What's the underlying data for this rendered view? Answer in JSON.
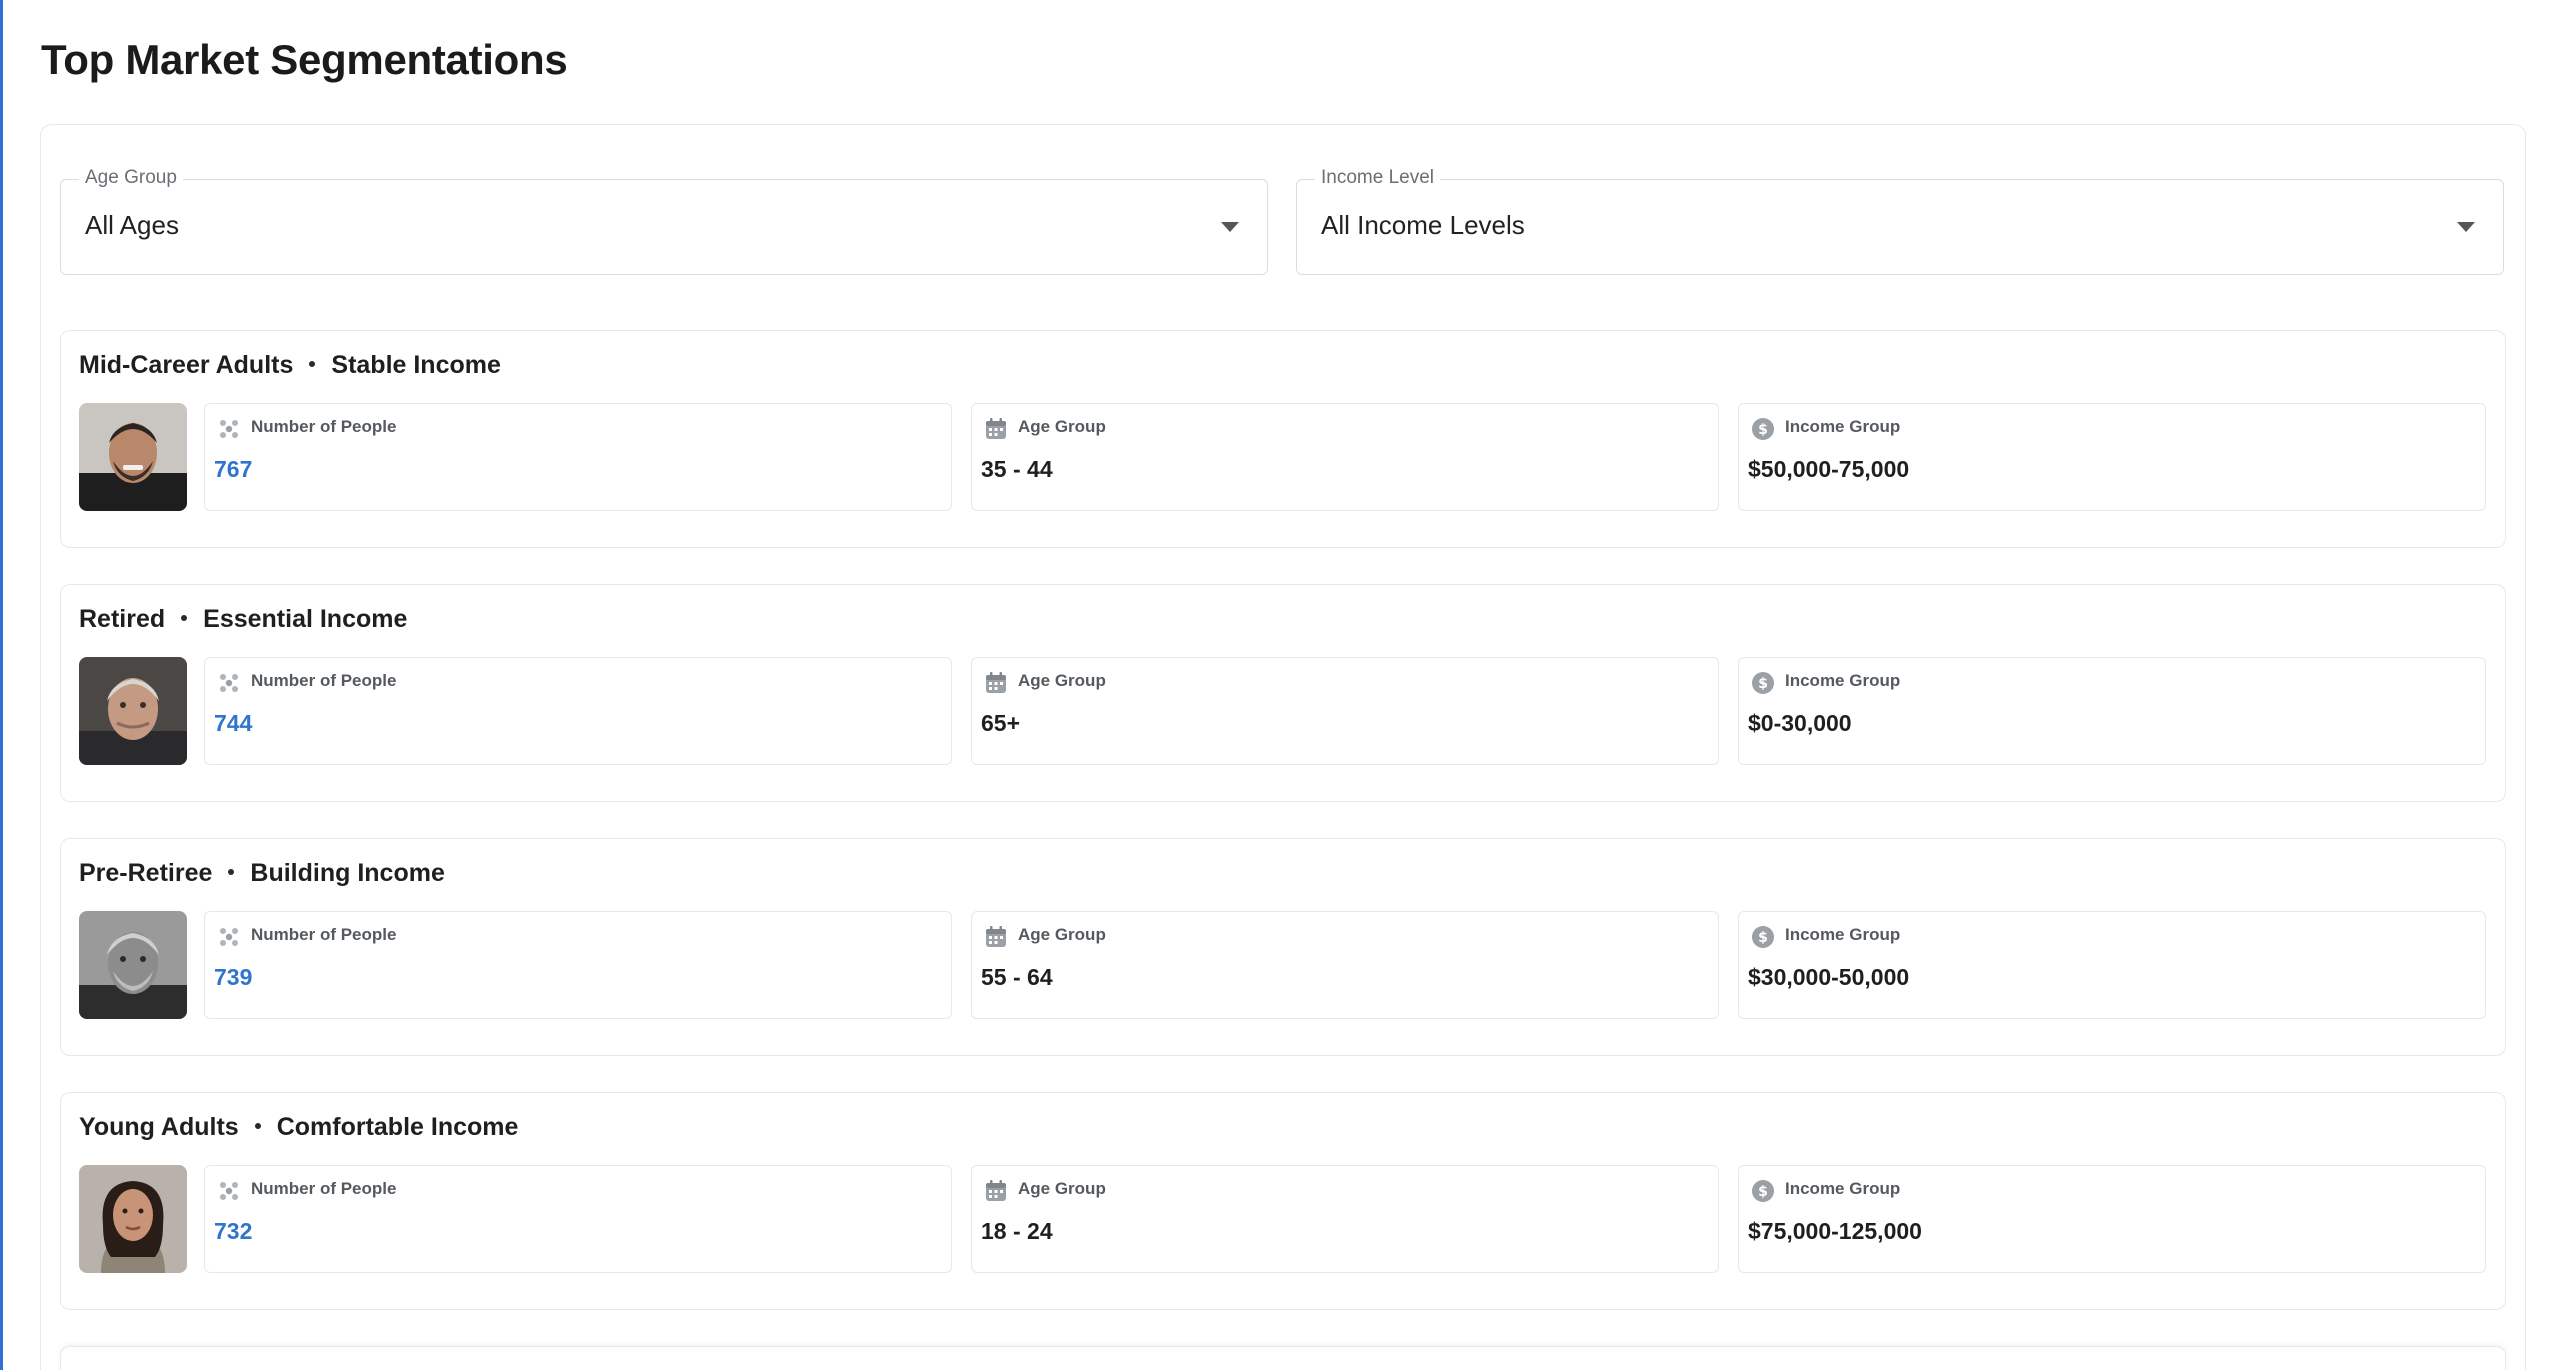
{
  "page": {
    "title": "Top Market Segmentations"
  },
  "filters": {
    "age": {
      "label": "Age Group",
      "value": "All Ages"
    },
    "income": {
      "label": "Income Level",
      "value": "All Income Levels"
    }
  },
  "stat_labels": {
    "people": "Number of People",
    "age": "Age Group",
    "income": "Income Group"
  },
  "segments": [
    {
      "name": "Mid-Career Adults",
      "income_name": "Stable Income",
      "people": "767",
      "age": "35 - 44",
      "income": "$50,000-75,000"
    },
    {
      "name": "Retired",
      "income_name": "Essential Income",
      "people": "744",
      "age": "65+",
      "income": "$0-30,000"
    },
    {
      "name": "Pre-Retiree",
      "income_name": "Building Income",
      "people": "739",
      "age": "55 - 64",
      "income": "$30,000-50,000"
    },
    {
      "name": "Young Adults",
      "income_name": "Comfortable Income",
      "people": "732",
      "age": "18 - 24",
      "income": "$75,000-125,000"
    }
  ],
  "colors": {
    "accent": "#2f74cf",
    "border": "#e6e8eb",
    "icon": "#9aa0a6"
  },
  "icons": {
    "people": "people-group-icon",
    "age": "calendar-icon",
    "income": "dollar-circle-icon",
    "dropdown": "caret-down-icon"
  }
}
